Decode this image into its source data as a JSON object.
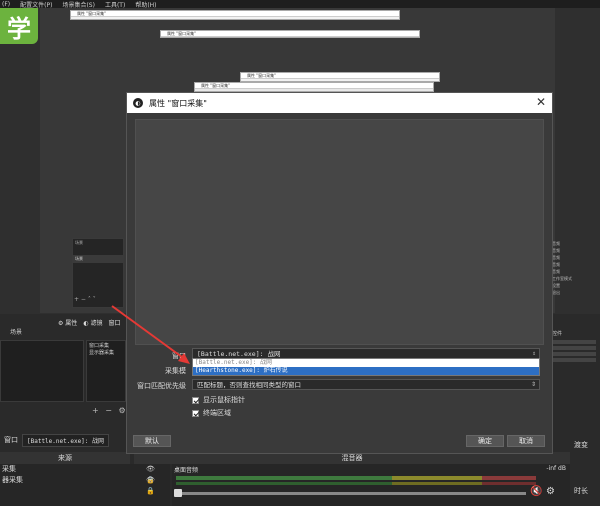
{
  "menubar": {
    "items": [
      "(F)",
      "配置文件(P)",
      "场景集合(S)",
      "工具(T)",
      "帮助(H)"
    ]
  },
  "logo": {
    "text": "学"
  },
  "recursive_titles": [
    "属性 \"窗口采集\"",
    "属性 \"窗口采集\"",
    "属性 \"窗口采集\""
  ],
  "mini_panel": {
    "header": "场景",
    "row": "场景",
    "toolbar": "+ − ˄ ˅"
  },
  "right_mini": [
    "音频",
    "音频",
    "音频",
    "音频",
    "音频",
    "工作室模式",
    "设置",
    "退出"
  ],
  "main_toolbar": {
    "properties": "属性",
    "filters": "滤镜",
    "window": "窗口"
  },
  "scenes_head": "场景",
  "sources_list_mini": [
    "窗口采集",
    "显示器采集"
  ],
  "src_toolbar": "+ − ⚙ ˄",
  "right_stat": {
    "header": "控件"
  },
  "bottom_strip": {
    "label": "窗口",
    "value": "[Battle.net.exe]: 战网"
  },
  "sources_title": "来源",
  "mixer_title": "混音器",
  "sources": [
    {
      "name": "采集",
      "icons": "👁 🔒"
    },
    {
      "name": "器采集",
      "icons": "👁 🔒"
    }
  ],
  "mixer": {
    "channel": "桌面音频",
    "db": "-inf dB"
  },
  "right_controls": {
    "top": "渡变",
    "bottom": "时长"
  },
  "dialog": {
    "title": "属性 \"窗口采集\"",
    "icon": "◐",
    "close": "✕",
    "window_label": "窗口",
    "window_value": "[Battle.net.exe]: 战网",
    "capture_method_label": "采集模",
    "match_priority_label": "窗口匹配优先级",
    "match_priority_value": "匹配标题，否则查找相同类型的窗口",
    "dropdown_items": [
      "[Battle.net.exe]: 战网",
      "[Hearthstone.exe]: 炉石传说"
    ],
    "show_cursor": "显示鼠标指针",
    "client_area": "终端区域",
    "defaults_btn": "默认",
    "ok_btn": "确定",
    "cancel_btn": "取消"
  },
  "colors": {
    "arrow": "#e53935",
    "selection": "#2d6fc4",
    "logo": "#6cb33e"
  }
}
